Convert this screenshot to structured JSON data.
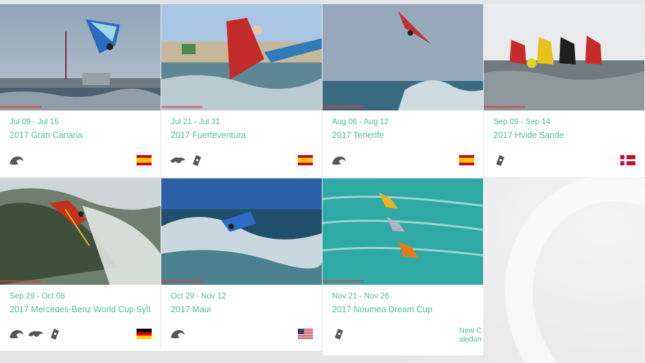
{
  "colors": {
    "accent": "#4cbf9b",
    "icon": "#555555"
  },
  "events": [
    {
      "date": "Jul 09 - Jul 15",
      "title": "2017 Gran Canaria",
      "icons": [
        "wave-icon"
      ],
      "flag": "Spain"
    },
    {
      "date": "Jul 21 - Jul 31",
      "title": "2017 Fuerteventura",
      "icons": [
        "freestyle-icon",
        "slalom-icon"
      ],
      "flag": "Spain"
    },
    {
      "date": "Aug 06 - Aug 12",
      "title": "2017 Tenerife",
      "icons": [
        "wave-icon"
      ],
      "flag": "Spain"
    },
    {
      "date": "Sep 09 - Sep 14",
      "title": "2017 Hvide Sande",
      "icons": [
        "slalom-icon"
      ],
      "flag": "Denmark"
    },
    {
      "date": "Sep 29 - Oct 08",
      "title": "2017 Mercedes-Benz World Cup Sylt",
      "icons": [
        "wave-icon",
        "freestyle-icon",
        "slalom-icon"
      ],
      "flag": "Germany"
    },
    {
      "date": "Oct 29 - Nov 12",
      "title": "2017 Maui",
      "icons": [
        "wave-icon"
      ],
      "flag": "USA"
    },
    {
      "date": "Nov 21 - Nov 26",
      "title": "2017 Noumea Dream Cup",
      "icons": [
        "slalom-icon"
      ],
      "flag_text": "New Caledon"
    }
  ]
}
